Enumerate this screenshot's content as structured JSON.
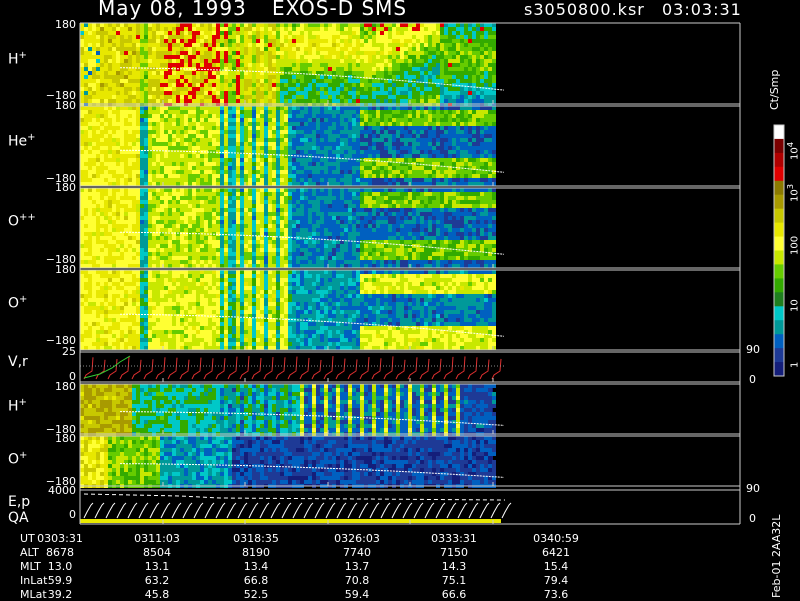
{
  "header": {
    "date": "May 08, 1993",
    "instrument": "EXOS-D SMS",
    "file": "s3050800.ksr",
    "time": "03:03:31"
  },
  "panels": [
    {
      "label_main": "H",
      "label_sup": "+",
      "ytop": "180",
      "ybot": "−180"
    },
    {
      "label_main": "He",
      "label_sup": "+",
      "ytop": "180",
      "ybot": "−180"
    },
    {
      "label_main": "O",
      "label_sup": "++",
      "ytop": "180",
      "ybot": "−180"
    },
    {
      "label_main": "O",
      "label_sup": "+",
      "ytop": "180",
      "ybot": "−180"
    }
  ],
  "vr_panel": {
    "label": "V,r",
    "ytop": "25",
    "ybot": "0",
    "rtop": "90",
    "rbot": "0"
  },
  "lower_panels": [
    {
      "label_main": "H",
      "label_sup": "+",
      "ytop": "180",
      "ybot": "−180"
    },
    {
      "label_main": "O",
      "label_sup": "+",
      "ytop": "180",
      "ybot": "−180"
    }
  ],
  "ep_panel": {
    "label1": "E,p",
    "label2": "QA",
    "ytop": "4000",
    "ybot": "0",
    "rtop": "90",
    "rbot": "0"
  },
  "colorbar": {
    "units": "Ct/Smp",
    "labels": [
      {
        "base": "10",
        "exp": "4"
      },
      {
        "base": "10",
        "exp": "3"
      },
      {
        "base": "100",
        "exp": ""
      },
      {
        "base": "10",
        "exp": ""
      },
      {
        "base": "1",
        "exp": ""
      }
    ],
    "colors": [
      "#ffffff",
      "#7a0000",
      "#b00000",
      "#e00000",
      "#8b7a00",
      "#a89a00",
      "#c8c800",
      "#e8e800",
      "#ffff33",
      "#c8e800",
      "#66cc00",
      "#33aa00",
      "#1f7f1f",
      "#00c8c8",
      "#009999",
      "#0060c0",
      "#1e3a96",
      "#141e7a"
    ]
  },
  "footer": {
    "labels": [
      "UT",
      "ALT",
      "MLT",
      "InLat",
      "MLat"
    ],
    "columns": [
      [
        "0303:31",
        "8678",
        "13.0",
        "59.9",
        "39.2"
      ],
      [
        "0311:03",
        "8504",
        "13.1",
        "63.2",
        "45.8"
      ],
      [
        "0318:35",
        "8190",
        "13.4",
        "66.8",
        "52.5"
      ],
      [
        "0326:03",
        "7740",
        "13.7",
        "70.8",
        "59.4"
      ],
      [
        "0333:31",
        "7150",
        "14.3",
        "75.1",
        "66.6"
      ],
      [
        "0340:59",
        "6421",
        "15.4",
        "79.4",
        "73.6"
      ]
    ],
    "id": "Feb-01 2AA32L"
  },
  "chart_data": {
    "type": "heatmap",
    "x_ticks": [
      "0303:31",
      "0311:03",
      "0318:35",
      "0326:03",
      "0333:31",
      "0340:59"
    ],
    "panels": [
      "H+",
      "He+",
      "O++",
      "O+",
      "V,r",
      "H+",
      "O+",
      "E,p QA"
    ],
    "ylim_angle": [
      -180,
      180
    ],
    "ylim_v": [
      0,
      25
    ],
    "ylim_e": [
      0,
      4000
    ],
    "colorbar_scale": "log",
    "colorbar_range": [
      1,
      10000
    ]
  }
}
